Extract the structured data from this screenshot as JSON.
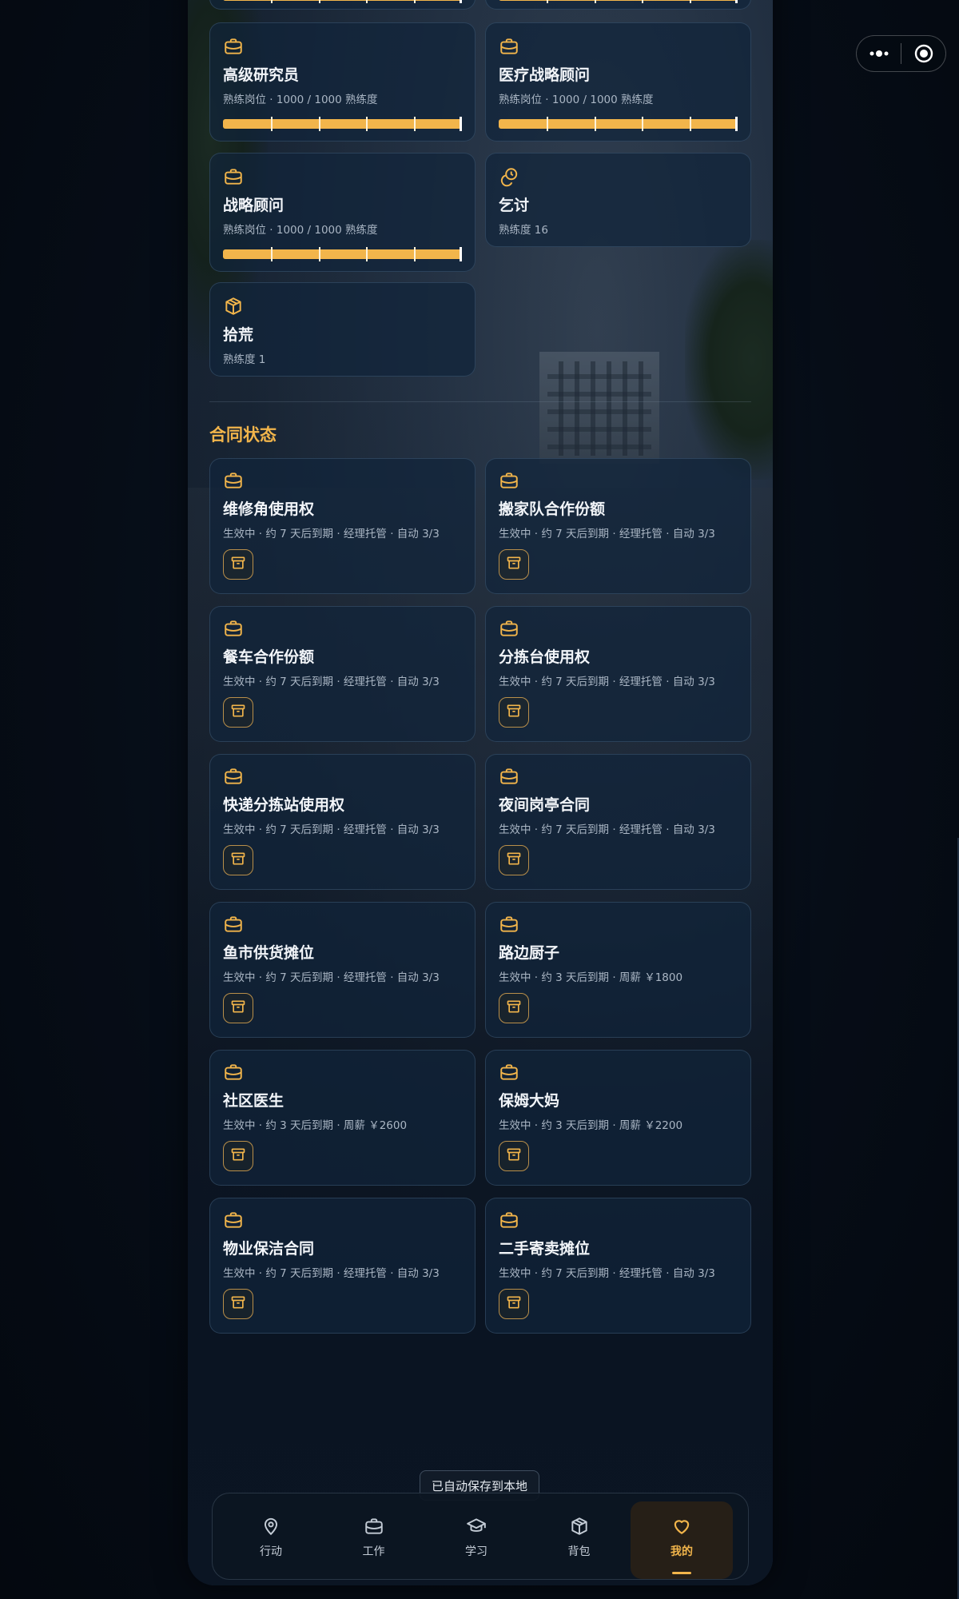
{
  "colors": {
    "accent": "#f2b54b",
    "card_bg": "#11243a",
    "text": "#f2f5f9",
    "muted": "#aab6c4"
  },
  "skills": [
    {
      "icon": "briefcase-icon",
      "title": "高级研究员",
      "sub": "熟练岗位 · 1000 / 1000 熟练度",
      "progress": 1.0
    },
    {
      "icon": "briefcase-icon",
      "title": "医疗战略顾问",
      "sub": "熟练岗位 · 1000 / 1000 熟练度",
      "progress": 1.0
    },
    {
      "icon": "briefcase-icon",
      "title": "战略顾问",
      "sub": "熟练岗位 · 1000 / 1000 熟练度",
      "progress": 1.0
    },
    {
      "icon": "coins-icon",
      "title": "乞讨",
      "sub": "熟练度 16"
    },
    {
      "icon": "box-icon",
      "title": "拾荒",
      "sub": "熟练度 1"
    }
  ],
  "section_title": "合同状态",
  "contracts": [
    {
      "title": "维修角使用权",
      "sub": "生效中 · 约 7 天后到期 · 经理托管 · 自动 3/3"
    },
    {
      "title": "搬家队合作份额",
      "sub": "生效中 · 约 7 天后到期 · 经理托管 · 自动 3/3"
    },
    {
      "title": "餐车合作份额",
      "sub": "生效中 · 约 7 天后到期 · 经理托管 · 自动 3/3"
    },
    {
      "title": "分拣台使用权",
      "sub": "生效中 · 约 7 天后到期 · 经理托管 · 自动 3/3"
    },
    {
      "title": "快递分拣站使用权",
      "sub": "生效中 · 约 7 天后到期 · 经理托管 · 自动 3/3"
    },
    {
      "title": "夜间岗亭合同",
      "sub": "生效中 · 约 7 天后到期 · 经理托管 · 自动 3/3"
    },
    {
      "title": "鱼市供货摊位",
      "sub": "生效中 · 约 7 天后到期 · 经理托管 · 自动 3/3"
    },
    {
      "title": "路边厨子",
      "sub": "生效中 · 约 3 天后到期 · 周薪 ￥1800"
    },
    {
      "title": "社区医生",
      "sub": "生效中 · 约 3 天后到期 · 周薪 ￥2600"
    },
    {
      "title": "保姆大妈",
      "sub": "生效中 · 约 3 天后到期 · 周薪 ￥2200"
    },
    {
      "title": "物业保洁合同",
      "sub": "生效中 · 约 7 天后到期 · 经理托管 · 自动 3/3"
    },
    {
      "title": "二手寄卖摊位",
      "sub": "生效中 · 约 7 天后到期 · 经理托管 · 自动 3/3"
    }
  ],
  "toast": "已自动保存到本地",
  "nav": {
    "items": [
      {
        "label": "行动",
        "icon": "map-pin-icon"
      },
      {
        "label": "工作",
        "icon": "briefcase-icon"
      },
      {
        "label": "学习",
        "icon": "graduation-cap-icon"
      },
      {
        "label": "背包",
        "icon": "box-icon"
      },
      {
        "label": "我的",
        "icon": "heart-icon",
        "active": true
      }
    ]
  }
}
